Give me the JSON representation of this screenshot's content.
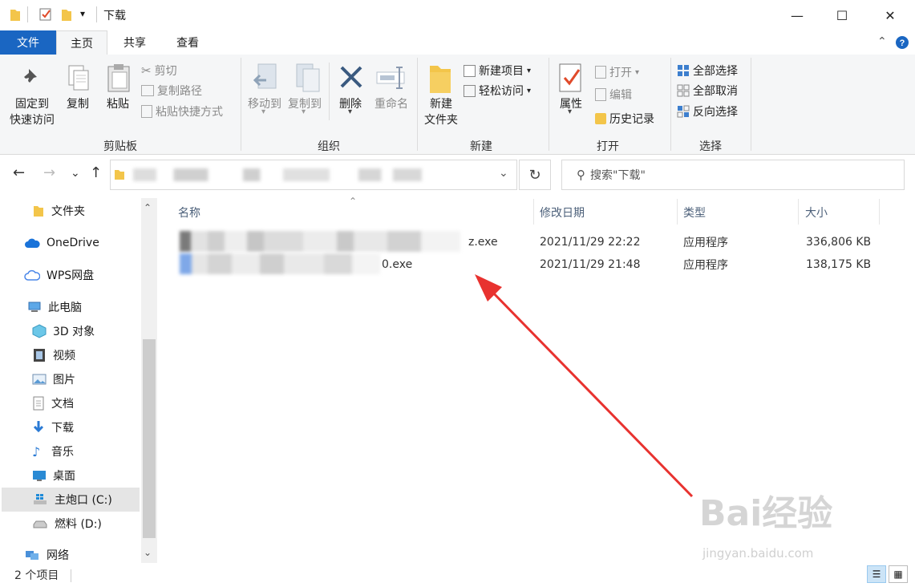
{
  "window": {
    "title": "下载",
    "controls": {
      "minimize": "—",
      "maximize": "☐",
      "close": "✕"
    }
  },
  "ribbon_tabs": [
    "文件",
    "主页",
    "共享",
    "查看"
  ],
  "ribbon": {
    "clipboard": {
      "pin_line1": "固定到",
      "pin_line2": "快速访问",
      "copy": "复制",
      "paste": "粘贴",
      "cut": "剪切",
      "copy_path": "复制路径",
      "paste_shortcut": "粘贴快捷方式",
      "group": "剪贴板"
    },
    "organize": {
      "move_to": "移动到",
      "copy_to": "复制到",
      "delete": "删除",
      "rename": "重命名",
      "group": "组织"
    },
    "new": {
      "new_folder_line1": "新建",
      "new_folder_line2": "文件夹",
      "new_item": "新建项目",
      "easy_access": "轻松访问",
      "group": "新建"
    },
    "open": {
      "properties": "属性",
      "open": "打开",
      "edit": "编辑",
      "history": "历史记录",
      "group": "打开"
    },
    "select": {
      "select_all": "全部选择",
      "select_none": "全部取消",
      "invert": "反向选择",
      "group": "选择"
    }
  },
  "nav": {
    "back": "←",
    "forward": "→",
    "recent": "⌄",
    "up": "↑",
    "refresh": "↻",
    "search_placeholder": "搜索\"下载\""
  },
  "sidebar": [
    {
      "label": "文件夹",
      "icon": "folder-icon"
    },
    {
      "label": "OneDrive",
      "icon": "cloud-icon"
    },
    {
      "label": "WPS网盘",
      "icon": "cloud-outline-icon"
    },
    {
      "label": "此电脑",
      "icon": "computer-icon"
    },
    {
      "label": "3D 对象",
      "icon": "cube-icon"
    },
    {
      "label": "视频",
      "icon": "film-icon"
    },
    {
      "label": "图片",
      "icon": "picture-icon"
    },
    {
      "label": "文档",
      "icon": "document-icon"
    },
    {
      "label": "下载",
      "icon": "download-icon"
    },
    {
      "label": "音乐",
      "icon": "music-icon"
    },
    {
      "label": "桌面",
      "icon": "desktop-icon"
    },
    {
      "label": "主炮口 (C:)",
      "icon": "windows-drive-icon"
    },
    {
      "label": "燃料 (D:)",
      "icon": "drive-icon"
    },
    {
      "label": "网络",
      "icon": "network-icon"
    }
  ],
  "columns": {
    "name": "名称",
    "modified": "修改日期",
    "type": "类型",
    "size": "大小"
  },
  "files": [
    {
      "name_tail": "z.exe",
      "modified": "2021/11/29 22:22",
      "type": "应用程序",
      "size": "336,806 KB"
    },
    {
      "name_tail": "0.exe",
      "modified": "2021/11/29 21:48",
      "type": "应用程序",
      "size": "138,175 KB"
    }
  ],
  "status": {
    "count": "2 个项目"
  },
  "watermark": {
    "brand": "Bai经验",
    "url": "jingyan.baidu.com"
  },
  "colors": {
    "accent": "#1a66c2",
    "arrow": "#e8322f",
    "header_text": "#4c607a"
  }
}
